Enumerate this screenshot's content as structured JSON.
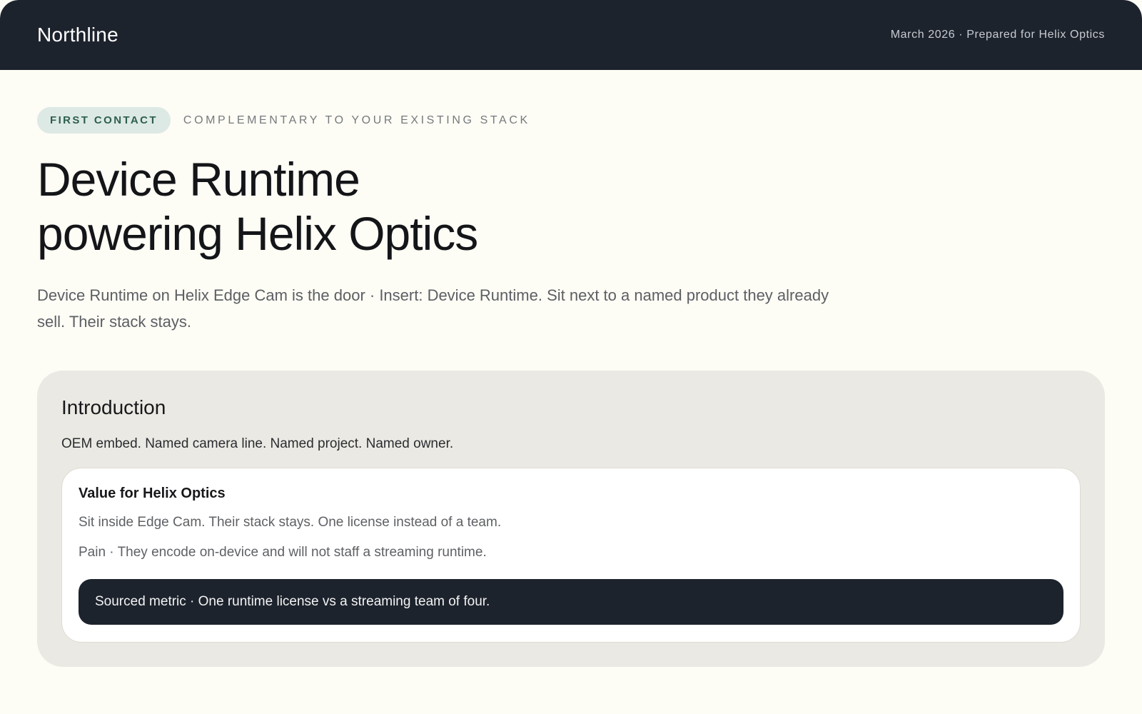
{
  "header": {
    "brand": "Northline",
    "meta": "March 2026 · Prepared for Helix Optics"
  },
  "hero": {
    "badge": "FIRST CONTACT",
    "eyebrow": "COMPLEMENTARY TO YOUR EXISTING STACK",
    "title_line_1": "Device Runtime",
    "title_line_2": "powering Helix Optics",
    "lede": "Device Runtime on Helix Edge Cam is the door · Insert: Device Runtime. Sit next to a named product they already sell. Their stack stays."
  },
  "introduction": {
    "title": "Introduction",
    "subtitle": "OEM embed. Named camera line. Named project. Named owner.",
    "value_card": {
      "title": "Value for Helix Optics",
      "line_1": "Sit inside Edge Cam. Their stack stays. One license instead of a team.",
      "line_2": "Pain · They encode on-device and will not staff a streaming runtime.",
      "metric": "Sourced metric · One runtime license vs a streaming team of four."
    }
  },
  "colors": {
    "header_bg": "#1d232c",
    "page_bg": "#fdfcf5",
    "badge_bg": "#dde9e4",
    "badge_text": "#2d5e50",
    "card_bg": "#ebe9e3",
    "metric_bg": "#1d232c"
  }
}
